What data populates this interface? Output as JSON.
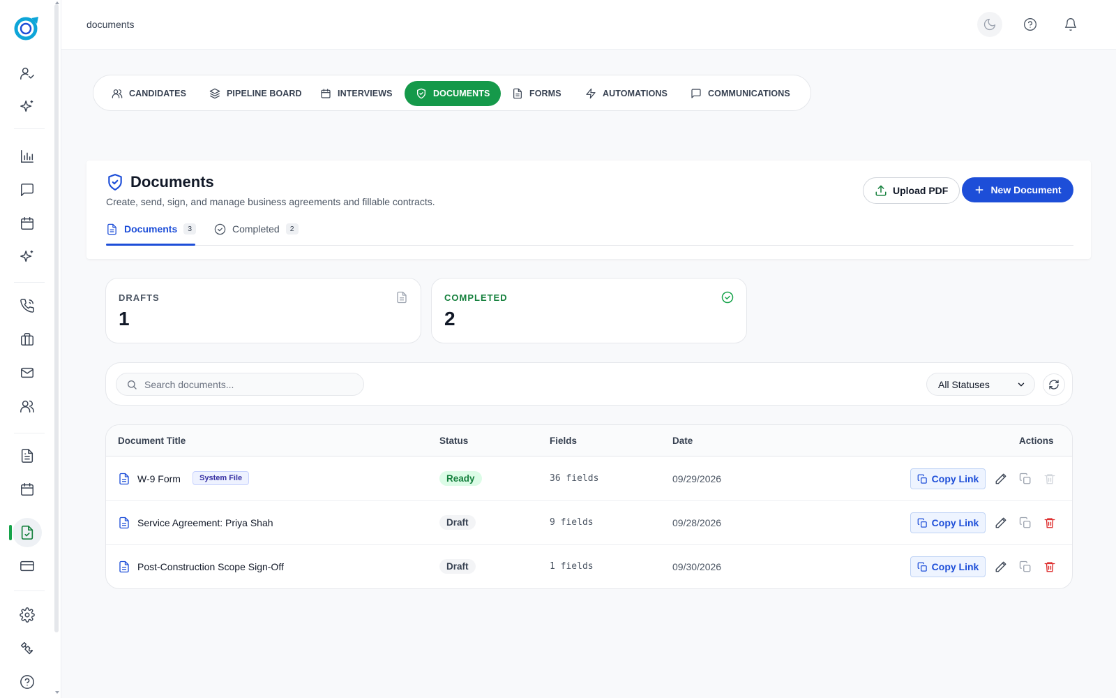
{
  "topbar": {
    "breadcrumb": "documents"
  },
  "module_tabs": [
    {
      "label": "CANDIDATES",
      "icon": "users-icon"
    },
    {
      "label": "PIPELINE BOARD",
      "icon": "layers-icon"
    },
    {
      "label": "INTERVIEWS",
      "icon": "calendar-icon"
    },
    {
      "label": "DOCUMENTS",
      "icon": "shield-check-icon",
      "active": true
    },
    {
      "label": "FORMS",
      "icon": "file-text-icon"
    },
    {
      "label": "AUTOMATIONS",
      "icon": "zap-icon"
    },
    {
      "label": "COMMUNICATIONS",
      "icon": "message-square-icon"
    }
  ],
  "header": {
    "title": "Documents",
    "subtitle": "Create, send, sign, and manage business agreements and fillable contracts.",
    "upload_label": "Upload PDF",
    "new_label": "New Document",
    "subtabs": [
      {
        "label": "Documents",
        "count": "3",
        "active": true
      },
      {
        "label": "Completed",
        "count": "2",
        "active": false
      }
    ]
  },
  "stats": {
    "drafts": {
      "label": "DRAFTS",
      "value": "1"
    },
    "completed": {
      "label": "COMPLETED",
      "value": "2"
    }
  },
  "filters": {
    "search_placeholder": "Search documents...",
    "status_selected": "All Statuses"
  },
  "table": {
    "columns": {
      "title": "Document Title",
      "status": "Status",
      "fields": "Fields",
      "date": "Date",
      "actions": "Actions"
    },
    "copy_label": "Copy Link",
    "rows": [
      {
        "title": "W-9 Form",
        "badge": "System File",
        "status": "Ready",
        "fields": "36 fields",
        "date": "09/29/2026"
      },
      {
        "title": "Service Agreement: Priya Shah",
        "badge": "",
        "status": "Draft",
        "fields": "9 fields",
        "date": "09/28/2026"
      },
      {
        "title": "Post-Construction Scope Sign-Off",
        "badge": "",
        "status": "Draft",
        "fields": "1 fields",
        "date": "09/30/2026"
      }
    ]
  },
  "colors": {
    "accent_green": "#15994a",
    "accent_blue": "#1d4ed8",
    "danger": "#dc2626"
  }
}
